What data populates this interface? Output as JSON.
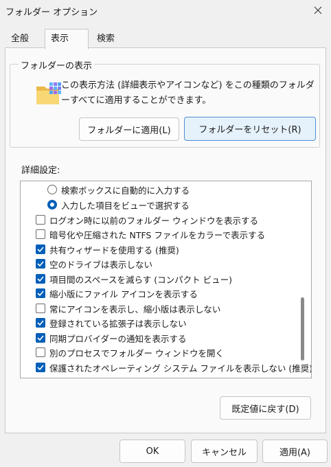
{
  "window": {
    "title": "フォルダー オプション"
  },
  "tabs": [
    {
      "label": "全般"
    },
    {
      "label": "表示"
    },
    {
      "label": "検索"
    }
  ],
  "folder_view": {
    "legend": "フォルダーの表示",
    "description": "この表示方法 (詳細表示やアイコンなど) をこの種類のフォルダーすべてに適用することができます。",
    "apply_button": "フォルダーに適用(L)",
    "reset_button": "フォルダーをリセット(R)"
  },
  "advanced": {
    "label": "詳細設定:",
    "items": [
      {
        "type": "radio",
        "checked": false,
        "label": "検索ボックスに自動的に入力する"
      },
      {
        "type": "radio",
        "checked": true,
        "label": "入力した項目をビューで選択する"
      },
      {
        "type": "checkbox",
        "checked": false,
        "label": "ログオン時に以前のフォルダー ウィンドウを表示する"
      },
      {
        "type": "checkbox",
        "checked": false,
        "label": "暗号化や圧縮された NTFS ファイルをカラーで表示する"
      },
      {
        "type": "checkbox",
        "checked": true,
        "label": "共有ウィザードを使用する (推奨)"
      },
      {
        "type": "checkbox",
        "checked": true,
        "label": "空のドライブは表示しない"
      },
      {
        "type": "checkbox",
        "checked": true,
        "label": "項目間のスペースを減らす (コンパクト ビュー)"
      },
      {
        "type": "checkbox",
        "checked": true,
        "label": "縮小版にファイル アイコンを表示する"
      },
      {
        "type": "checkbox",
        "checked": false,
        "label": "常にアイコンを表示し、縮小版は表示しない"
      },
      {
        "type": "checkbox",
        "checked": true,
        "label": "登録されている拡張子は表示しない"
      },
      {
        "type": "checkbox",
        "checked": true,
        "label": "同期プロバイダーの通知を表示する"
      },
      {
        "type": "checkbox",
        "checked": false,
        "label": "別のプロセスでフォルダー ウィンドウを開く"
      },
      {
        "type": "checkbox",
        "checked": true,
        "label": "保護されたオペレーティング システム ファイルを表示しない (推奨)"
      }
    ],
    "restore_button": "既定値に戻す(D)"
  },
  "footer": {
    "ok": "OK",
    "cancel": "キャンセル",
    "apply": "適用(A)"
  },
  "colors": {
    "accent": "#005fb8",
    "primary_button_bg": "#e5f1fb"
  }
}
